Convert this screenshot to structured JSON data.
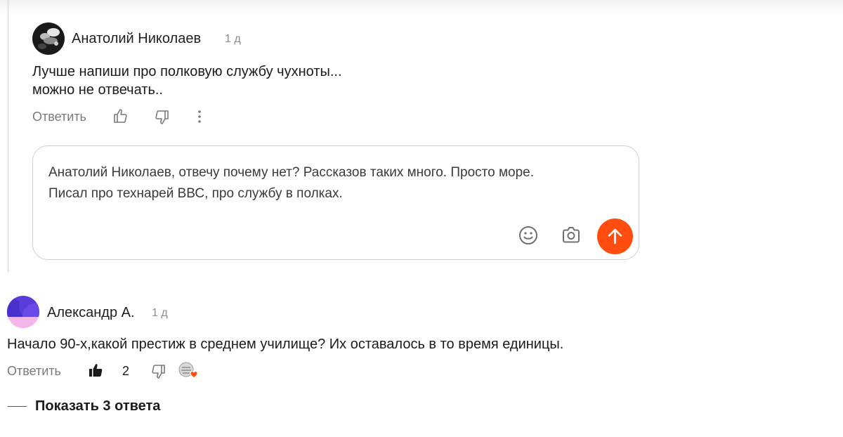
{
  "colors": {
    "accent": "#ff4d0f",
    "muted_text": "#7a7a7a",
    "border": "#cfcfcf"
  },
  "comment1": {
    "author": "Анатолий Николаев",
    "time": "1 д",
    "text_line1": "Лучше напиши про полковую службу чухноты...",
    "text_line2": "можно не отвечать..",
    "reply_label": "Ответить",
    "icons": [
      "like-icon",
      "dislike-icon",
      "more-icon"
    ]
  },
  "reply_box": {
    "text_line1": "Анатолий Николаев, отвечу почему нет? Рассказов таких много. Просто море.",
    "text_line2": "Писал про технарей ВВС, про службу в полках.",
    "icons": [
      "emoji-icon",
      "camera-icon",
      "send-arrow-icon"
    ]
  },
  "comment2": {
    "author": "Александр А.",
    "time": "1 д",
    "text": "Начало 90-х,какой престиж в среднем училище? Их оставалось в то время единицы.",
    "reply_label": "Ответить",
    "likes": "2",
    "icons": [
      "like-filled-icon",
      "dislike-icon",
      "author-liked-icon"
    ]
  },
  "show_replies": {
    "label": "Показать 3 ответа"
  }
}
